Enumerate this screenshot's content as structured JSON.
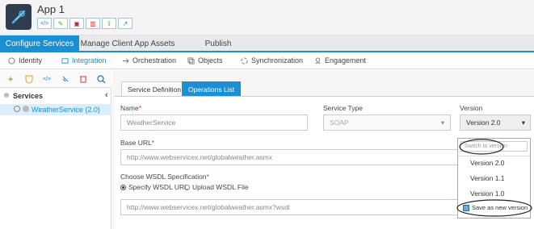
{
  "app": {
    "title": "App 1"
  },
  "tabs": [
    "Configure Services",
    "Manage Client App Assets",
    "Publish"
  ],
  "subnav": [
    "Identity",
    "Integration",
    "Orchestration",
    "Objects",
    "Synchronization",
    "Engagement"
  ],
  "sidebar": {
    "heading": "Services",
    "item": "WeatherService (2.0)"
  },
  "content_tabs": [
    "Service Definition",
    "Operations List"
  ],
  "form": {
    "name_label": "Name",
    "name_value": "WeatherService",
    "service_type_label": "Service Type",
    "service_type_value": "SOAP",
    "version_label": "Version",
    "version_value": "Version 2.0",
    "base_url_label": "Base URL",
    "base_url_value": "http://www.webservicex.net/globalweather.asmx",
    "wsdl_label": "Choose WSDL Specification",
    "wsdl_opt1": "Specify WSDL URL",
    "wsdl_opt2": "Upload WSDL File",
    "wsdl_value": "http://www.webservicex.net/globalweather.asmx?wsdl",
    "required_mark": "*"
  },
  "version_menu": {
    "placeholder": "Switch to version",
    "options": [
      "Version 2.0",
      "Version 1.1",
      "Version 1.0"
    ],
    "save_new": "Save as new version"
  },
  "colors": {
    "accent": "#1a8fd3",
    "header_bg": "#f4f4f4",
    "logo_bg": "#2f3e4f"
  }
}
